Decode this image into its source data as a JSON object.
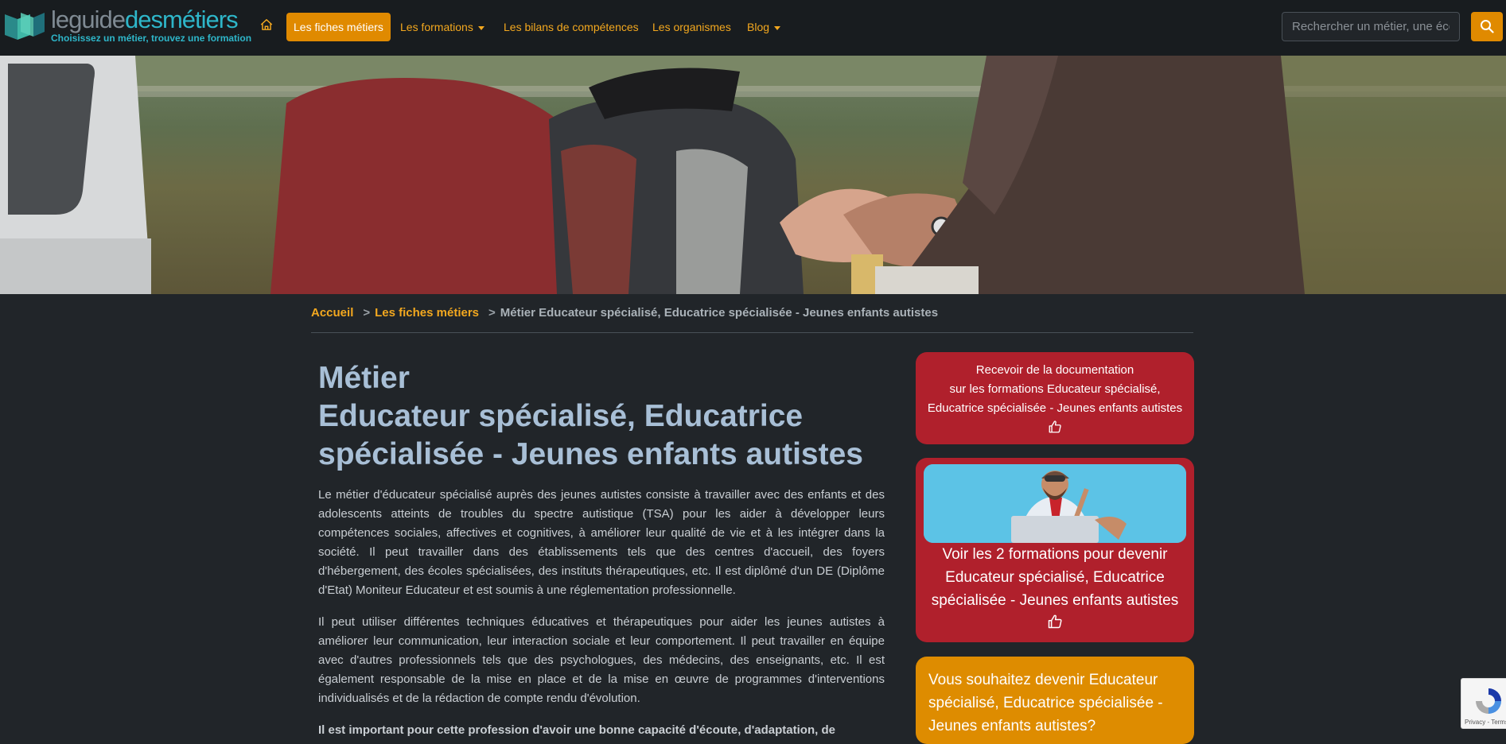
{
  "header": {
    "logo": {
      "word1": "leguide",
      "word2": "desmétiers",
      "tagline": "Choisissez un métier, trouvez une formation"
    },
    "nav": [
      {
        "label": "Les fiches métiers"
      },
      {
        "label": "Les formations"
      },
      {
        "label": "Les bilans de compétences"
      },
      {
        "label": "Les organismes"
      },
      {
        "label": "Blog"
      }
    ],
    "search": {
      "placeholder": "Rechercher un métier, une école..."
    }
  },
  "breadcrumb": {
    "home": "Accueil",
    "fiches": "Les fiches métiers",
    "separator": ">",
    "current": "Métier Educateur spécialisé, Educatrice spécialisée - Jeunes enfants autistes"
  },
  "main": {
    "title_line1": "Métier",
    "title_line2": "Educateur spécialisé, Educatrice",
    "title_line3": "spécialisée - Jeunes enfants autistes",
    "paragraphs": [
      "Le métier d'éducateur spécialisé auprès des jeunes autistes consiste à travailler avec des enfants et des adolescents atteints de troubles du spectre autistique (TSA) pour les aider à développer leurs compétences sociales, affectives et cognitives, à améliorer leur qualité de vie et à les intégrer dans la société. Il peut travailler dans des établissements tels que des centres d'accueil, des foyers d'hébergement, des écoles spécialisées, des instituts thérapeutiques, etc. Il est diplômé d'un DE (Diplôme d'Etat) Moniteur Educateur et est soumis à une réglementation professionnelle.",
      "Il peut utiliser différentes techniques éducatives et thérapeutiques pour aider les jeunes autistes à améliorer leur communication, leur interaction sociale et leur comportement. Il peut travailler en équipe avec d'autres professionnels tels que des psychologues, des médecins, des enseignants, etc. Il est également responsable de la mise en place et de la mise en œuvre de programmes d'interventions individualisés et de la rédaction de compte rendu d'évolution.",
      "Il est important pour cette profession d'avoir une bonne capacité d'écoute, d'adaptation, de"
    ]
  },
  "sidebar": {
    "doc_card": {
      "line1": "Recevoir de la documentation",
      "line2": "sur les formations Educateur spécialisé,",
      "line3": "Educatrice spécialisée - Jeunes enfants autistes"
    },
    "formations_card": {
      "line1": "Voir les 2 formations pour devenir",
      "line2": "Educateur spécialisé, Educatrice",
      "line3": "spécialisée - Jeunes enfants autistes"
    },
    "question_card": {
      "line1": "Vous souhaitez devenir Educateur",
      "line2": "spécialisé, Educatrice spécialisée -",
      "line3": "Jeunes enfants autistes?"
    }
  },
  "recaptcha": {
    "links": "Privacy - Terms"
  },
  "colors": {
    "accent": "#e08a00",
    "card_red": "#b0202c",
    "card_orange": "#de8c00",
    "title": "#a8bfd6",
    "background": "#212529"
  }
}
